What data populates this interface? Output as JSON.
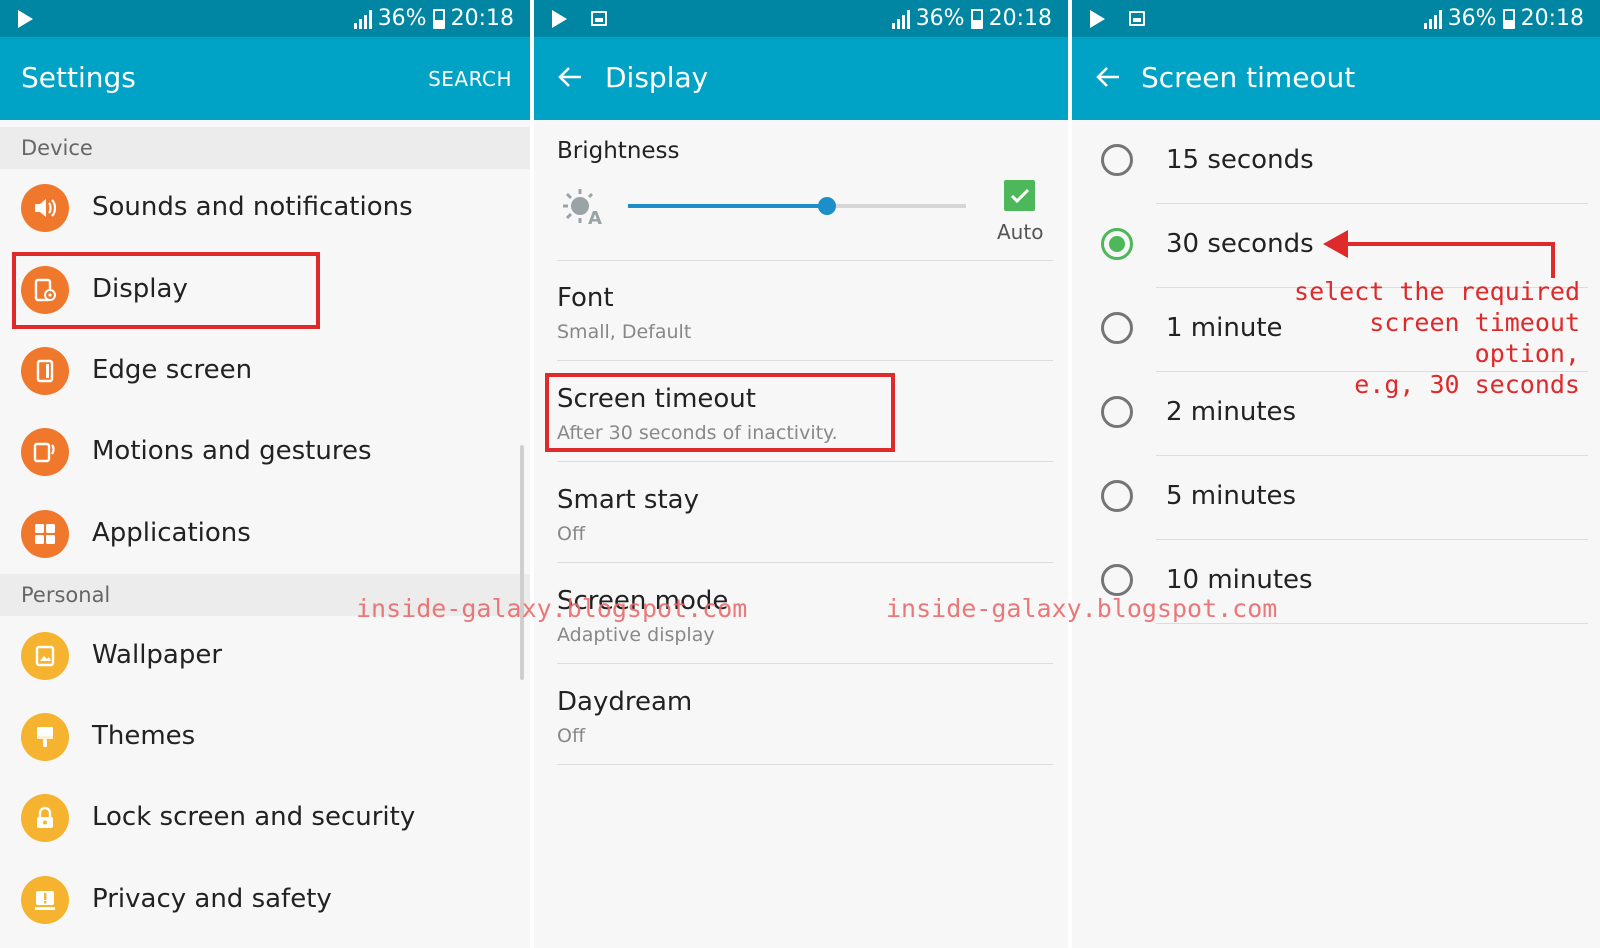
{
  "status": {
    "battery_pct": "36%",
    "time": "20:18"
  },
  "settings": {
    "title": "Settings",
    "search": "SEARCH",
    "device_header": "Device",
    "personal_header": "Personal",
    "device_items": [
      {
        "label": "Sounds and notifications",
        "icon": "speaker-icon"
      },
      {
        "label": "Display",
        "icon": "display-icon"
      },
      {
        "label": "Edge screen",
        "icon": "edge-screen-icon"
      },
      {
        "label": "Motions and gestures",
        "icon": "motion-icon"
      },
      {
        "label": "Applications",
        "icon": "applications-icon"
      }
    ],
    "personal_items": [
      {
        "label": "Wallpaper",
        "icon": "wallpaper-icon"
      },
      {
        "label": "Themes",
        "icon": "themes-icon"
      },
      {
        "label": "Lock screen and security",
        "icon": "lock-icon"
      },
      {
        "label": "Privacy and safety",
        "icon": "privacy-icon"
      }
    ]
  },
  "display": {
    "title": "Display",
    "brightness_label": "Brightness",
    "brightness_level": 0.59,
    "auto_label": "Auto",
    "auto_checked": true,
    "items": [
      {
        "title": "Font",
        "subtitle": "Small, Default"
      },
      {
        "title": "Screen timeout",
        "subtitle": "After 30 seconds of inactivity."
      },
      {
        "title": "Smart stay",
        "subtitle": "Off"
      },
      {
        "title": "Screen mode",
        "subtitle": "Adaptive display"
      },
      {
        "title": "Daydream",
        "subtitle": "Off"
      }
    ]
  },
  "timeout": {
    "title": "Screen timeout",
    "options": [
      "15 seconds",
      "30 seconds",
      "1 minute",
      "2 minutes",
      "5 minutes",
      "10 minutes"
    ],
    "selected": "30 seconds"
  },
  "annotation": {
    "line1": "select the required",
    "line2": "screen timeout",
    "line3": "option,",
    "line4": "e.g, 30 seconds"
  },
  "watermark": "inside-galaxy.blogspot.com",
  "colors": {
    "statusbar": "#0086a3",
    "appbar": "#00a3c6",
    "accent_green": "#4cb85a",
    "highlight_red": "#de2a2a",
    "orange_icon": "#f0782c",
    "yellow_icon": "#f5b32f"
  }
}
